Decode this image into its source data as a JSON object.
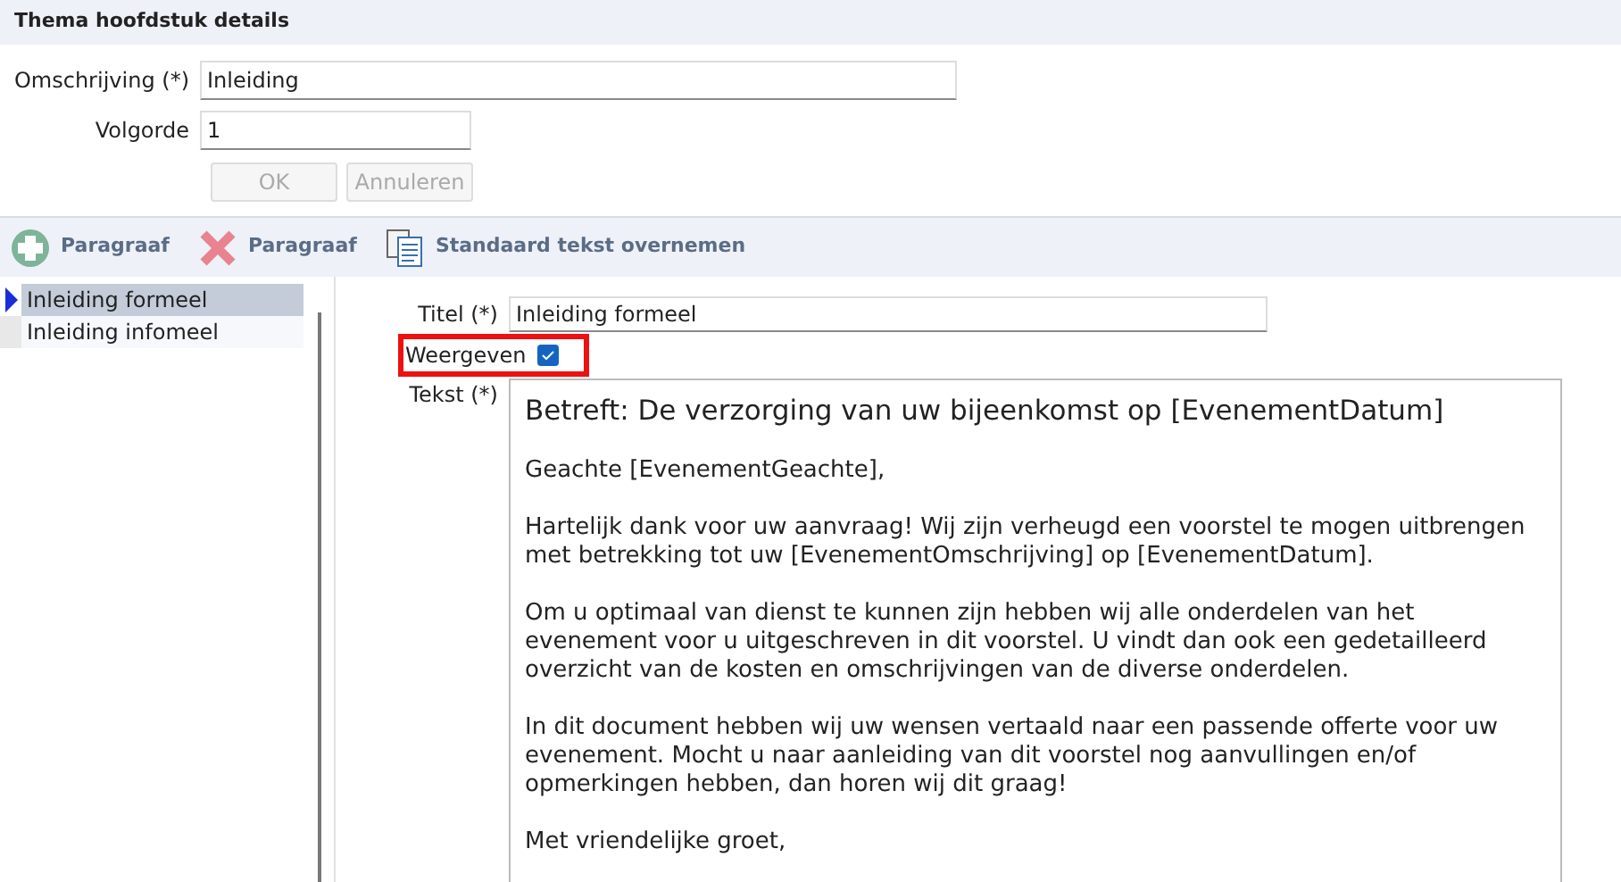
{
  "header": {
    "title": "Thema hoofdstuk details"
  },
  "form": {
    "fields": [
      {
        "label": "Omschrijving (*)",
        "value": "Inleiding",
        "wide": true
      },
      {
        "label": "Volgorde",
        "value": "1",
        "wide": false
      }
    ],
    "buttons": [
      {
        "label": "OK",
        "disabled": true
      },
      {
        "label": "Annuleren",
        "disabled": true
      }
    ]
  },
  "toolbar": [
    {
      "kind": "add",
      "label": "Paragraaf"
    },
    {
      "kind": "delete",
      "label": "Paragraaf"
    },
    {
      "kind": "copy",
      "label": "Standaard tekst overnemen"
    }
  ],
  "paragraphs": [
    {
      "label": "Inleiding formeel",
      "selected": true
    },
    {
      "label": "Inleiding infomeel",
      "selected": false
    }
  ],
  "detail": {
    "title_label": "Titel (*)",
    "title_value": "Inleiding formeel",
    "show_label": "Weergeven",
    "show_checked": true,
    "show_highlighted": true,
    "text_label": "Tekst (*)",
    "text_heading": "Betreft: De verzorging van uw bijeenkomst op [EvenementDatum]",
    "text_paragraphs": [
      "Geachte [EvenementGeachte],",
      "Hartelijk dank voor uw aanvraag! Wij zijn verheugd een voorstel te mogen uitbrengen met betrekking tot uw [EvenementOmschrijving] op [EvenementDatum].",
      "Om u optimaal van dienst te kunnen zijn hebben wij alle onderdelen van het evenement voor u uitgeschreven in dit voorstel. U vindt dan ook een gedetailleerd overzicht van de kosten en omschrijvingen van de diverse onderdelen.",
      "In dit document hebben wij uw wensen vertaald naar een passende offerte voor uw evenement. Mocht u naar aanleiding van dit voorstel nog aanvullingen en/of opmerkingen hebben, dan horen wij dit graag!",
      "Met vriendelijke groet,"
    ]
  }
}
